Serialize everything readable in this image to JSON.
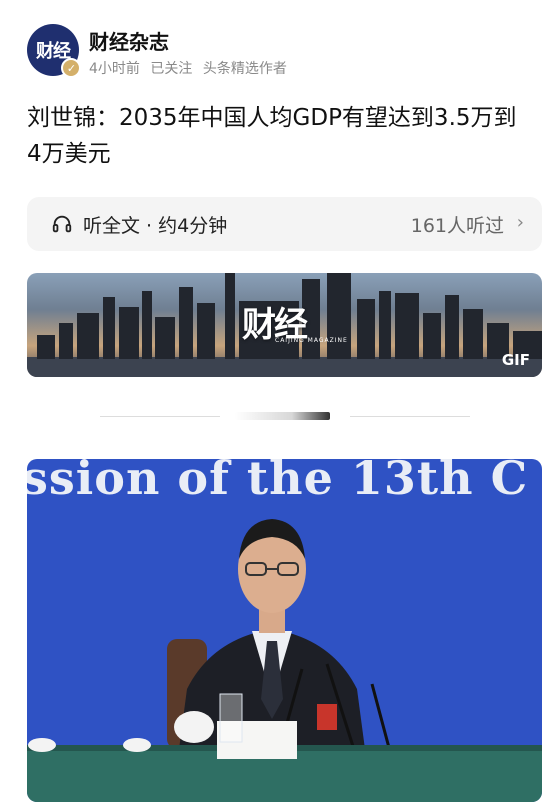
{
  "header": {
    "avatar_text": "财经",
    "account_name": "财经杂志",
    "time_ago": "4小时前",
    "follow_status": "已关注",
    "author_tag": "头条精选作者"
  },
  "article": {
    "title": "刘世锦：2035年中国人均GDP有望达到3.5万到4万美元"
  },
  "listen": {
    "label": "听全文 · 约4分钟",
    "count": "161人听过",
    "icon": "headphone-icon"
  },
  "gif_banner": {
    "logo": "财经",
    "subtitle": "CAIJING MAGAZINE",
    "badge": "GIF"
  },
  "photo": {
    "backdrop_text": "ssion of the 13th C"
  }
}
